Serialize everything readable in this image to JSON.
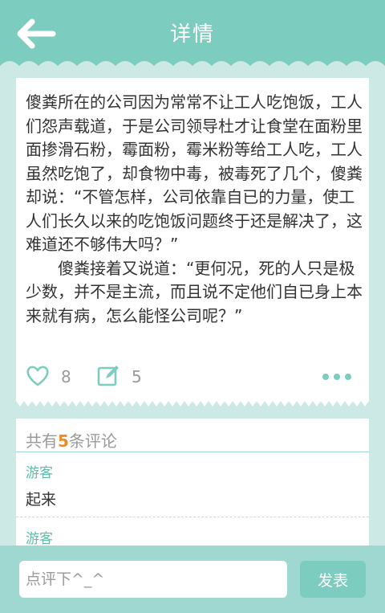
{
  "header": {
    "title": "详情",
    "back_icon": "arrow-left-icon"
  },
  "post": {
    "content": "傻粪所在的公司因为常常不让工人吃饱饭，工人们怨声载道，于是公司领导杜才让食堂在面粉里面掺滑石粉，霉面粉，霉米粉等给工人吃，工人虽然吃饱了，却食物中毒，被毒死了几个，傻粪却说：“不管怎样，公司依靠自已的力量，使工人们长久以来的吃饱饭问题终于还是解决了，这难道还不够伟大吗？”\n　　傻粪接着又说道：“更何况，死的人只是极少数，并不是主流，而且说不定他们自已身上本来就有病，怎么能怪公司呢？”",
    "like_count": "8",
    "comment_count": "5",
    "like_icon": "heart-icon",
    "comment_icon": "edit-icon",
    "more_icon": "more-dots-icon"
  },
  "comments_section": {
    "heading_prefix": "共有",
    "heading_count": "5",
    "heading_suffix": "条评论",
    "items": [
      {
        "user": "游客",
        "content": "起来"
      },
      {
        "user": "游客",
        "content": ""
      }
    ]
  },
  "bottom_bar": {
    "input_placeholder": "点评下^_^",
    "send_label": "发表"
  },
  "colors": {
    "accent": "#7dccc0",
    "background": "#cde9e5",
    "count_highlight": "#f08a24"
  }
}
